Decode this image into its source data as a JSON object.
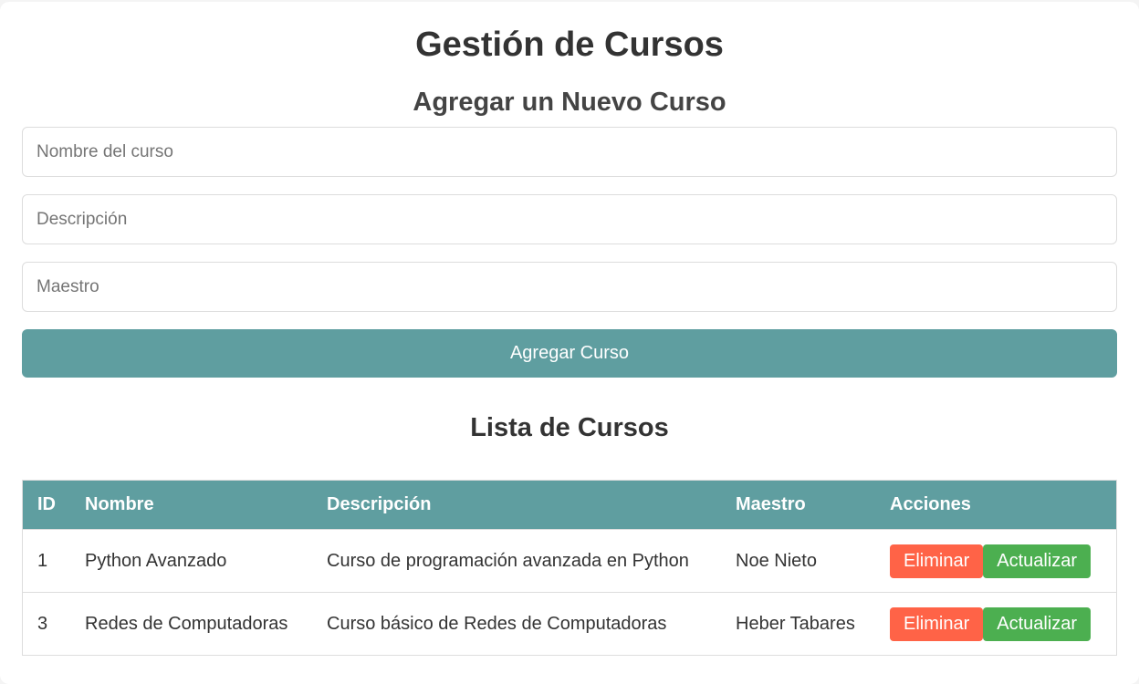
{
  "page": {
    "title": "Gestión de Cursos"
  },
  "form": {
    "title": "Agregar un Nuevo Curso",
    "nombre_placeholder": "Nombre del curso",
    "descripcion_placeholder": "Descripción",
    "maestro_placeholder": "Maestro",
    "submit_label": "Agregar Curso"
  },
  "list": {
    "title": "Lista de Cursos",
    "columns": [
      "ID",
      "Nombre",
      "Descripción",
      "Maestro",
      "Acciones"
    ],
    "rows": [
      {
        "id": "1",
        "nombre": "Python Avanzado",
        "descripcion": "Curso de programación avanzada en Python",
        "maestro": "Noe Nieto"
      },
      {
        "id": "3",
        "nombre": "Redes de Computadoras",
        "descripcion": "Curso básico de Redes de Computadoras",
        "maestro": "Heber Tabares"
      }
    ],
    "delete_label": "Eliminar",
    "update_label": "Actualizar"
  },
  "colors": {
    "accent": "#5f9ea0",
    "delete": "#ff6347",
    "update": "#4caf50"
  }
}
